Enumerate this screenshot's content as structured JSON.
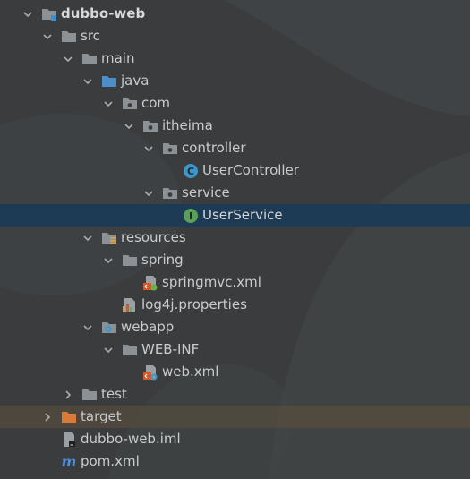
{
  "tree": {
    "rows": [
      {
        "label": "dubbo-web",
        "icon": "module-folder-icon",
        "expanded": true,
        "bold": true
      },
      {
        "label": "src",
        "icon": "folder-icon",
        "expanded": true
      },
      {
        "label": "main",
        "icon": "folder-icon",
        "expanded": true
      },
      {
        "label": "java",
        "icon": "source-root-folder-icon",
        "expanded": true
      },
      {
        "label": "com",
        "icon": "package-icon",
        "expanded": true
      },
      {
        "label": "itheima",
        "icon": "package-icon",
        "expanded": true
      },
      {
        "label": "controller",
        "icon": "package-icon",
        "expanded": true
      },
      {
        "label": "UserController",
        "icon": "java-class-icon"
      },
      {
        "label": "service",
        "icon": "package-icon",
        "expanded": true
      },
      {
        "label": "UserService",
        "icon": "java-interface-icon",
        "selected": true
      },
      {
        "label": "resources",
        "icon": "resources-folder-icon",
        "expanded": true
      },
      {
        "label": "spring",
        "icon": "folder-icon",
        "expanded": true
      },
      {
        "label": "springmvc.xml",
        "icon": "spring-xml-file-icon"
      },
      {
        "label": "log4j.properties",
        "icon": "properties-file-icon"
      },
      {
        "label": "webapp",
        "icon": "web-folder-icon",
        "expanded": true
      },
      {
        "label": "WEB-INF",
        "icon": "folder-icon",
        "expanded": true
      },
      {
        "label": "web.xml",
        "icon": "web-xml-file-icon"
      },
      {
        "label": "test",
        "icon": "folder-icon",
        "expanded": false
      },
      {
        "label": "target",
        "icon": "excluded-folder-icon",
        "expanded": false
      },
      {
        "label": "dubbo-web.iml",
        "icon": "iml-file-icon"
      },
      {
        "label": "pom.xml",
        "icon": "maven-file-icon",
        "icon_text": "m"
      }
    ]
  },
  "colors": {
    "background": "#3a3c3e",
    "selection": "#1d3b55",
    "excluded_row": "#4e463a",
    "folder": "#8c9196",
    "source_root": "#4d8ec8",
    "class_badge": "#3e96c8",
    "interface_badge": "#5aa05a",
    "excluded_folder": "#d97a38"
  }
}
